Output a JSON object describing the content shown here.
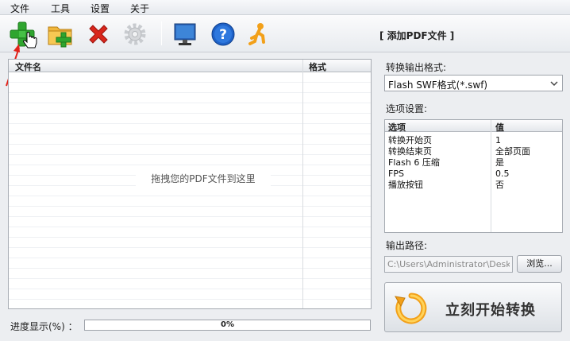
{
  "menu": [
    "文件",
    "工具",
    "设置",
    "关于"
  ],
  "toolbar": {
    "title": "[ 添加PDF文件 ]",
    "buttons": [
      "add-file-icon",
      "add-folder-icon",
      "delete-icon",
      "settings-icon",
      "monitor-icon",
      "help-icon",
      "run-icon"
    ]
  },
  "file_list": {
    "col_name": "文件名",
    "col_format": "格式",
    "drop_hint": "拖拽您的PDF文件到这里"
  },
  "progress": {
    "label": "进度显示(%) ：",
    "value": 0,
    "text": "0%"
  },
  "output_format": {
    "label": "转换输出格式:",
    "selected": "Flash SWF格式(*.swf)"
  },
  "options": {
    "label": "选项设置:",
    "col_option": "选项",
    "col_value": "值",
    "rows": [
      {
        "key": "转换开始页",
        "value": "1"
      },
      {
        "key": "转换结束页",
        "value": "全部页面"
      },
      {
        "key": "Flash 6 压缩",
        "value": "是"
      },
      {
        "key": "FPS",
        "value": "0.5"
      },
      {
        "key": "播放按钮",
        "value": "否"
      }
    ]
  },
  "output_path": {
    "label": "输出路径:",
    "value": "C:\\Users\\Administrator\\Deskt",
    "browse": "浏览..."
  },
  "start_button": "立刻开始转换",
  "colors": {
    "accent_green": "#2fa52f",
    "delete_red": "#d9261c",
    "progress_blue": "#5aa0e0"
  }
}
